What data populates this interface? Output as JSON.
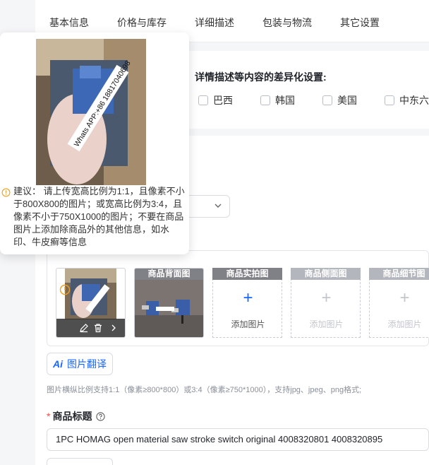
{
  "tabs": [
    "基本信息",
    "价格与库存",
    "详细描述",
    "包装与物流",
    "其它设置"
  ],
  "differentiation": {
    "title": "详情描述等内容的差异化设置:",
    "regions": [
      "巴西",
      "韩国",
      "美国",
      "中东六"
    ]
  },
  "popover": {
    "photo_overlay_text": "Whats APP:+86 18817040698",
    "tip_text": "建议：  请上传宽高比例为1:1，且像素不小于800X800的图片；或宽高比例为3:4，且像素不小于750X1000的图片；不要在商品图片上添加除商品外的其他信息，如水印、牛皮癣等信息"
  },
  "image_slots": {
    "back": {
      "title": "商品背面图"
    },
    "real": {
      "title": "商品实拍图",
      "add_label": "添加图片"
    },
    "side": {
      "title": "商品侧面图",
      "add_label": "添加图片"
    },
    "detail": {
      "title": "商品细节图",
      "add_label": "添加图片"
    }
  },
  "translate_button": {
    "ai_label": "Ai",
    "label": "图片翻译"
  },
  "image_hint": "图片横纵比例支持1:1（像素≥800*800）或3:4（像素≥750*1000），支持jpg、jpeg、png格式;",
  "product_title": {
    "required_mark": "*",
    "label": "商品标题",
    "value": "1PC HOMAG open material saw stroke switch original 4008320801 4008320895"
  },
  "colors": {
    "accent": "#1966ff",
    "required": "#f54a45",
    "warning": "#f0a020"
  },
  "icons": [
    "warning-icon",
    "chevron-down-icon",
    "edit-icon",
    "delete-icon",
    "chevron-right-icon",
    "help-icon",
    "plus-icon"
  ]
}
